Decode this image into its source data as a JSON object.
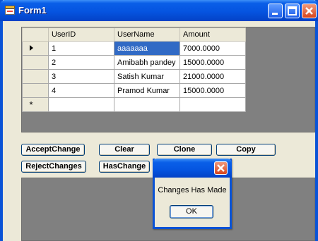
{
  "window": {
    "title": "Form1"
  },
  "grid": {
    "columns": [
      "UserID",
      "UserName",
      "Amount"
    ],
    "rows": [
      {
        "id": "1",
        "name": "aaaaaaa",
        "amount": "7000.0000"
      },
      {
        "id": "2",
        "name": "Amibabh pandey",
        "amount": "15000.0000"
      },
      {
        "id": "3",
        "name": "Satish Kumar",
        "amount": "21000.0000"
      },
      {
        "id": "4",
        "name": "Pramod Kumar",
        "amount": "15000.0000"
      }
    ],
    "new_row_marker": "*",
    "selected_row": 0,
    "selected_column": "UserName"
  },
  "buttons": {
    "accept": "AcceptChange",
    "clear": "Clear",
    "clone": "Clone",
    "copy": "Copy",
    "reject": "RejectChanges",
    "haschange": "HasChange"
  },
  "dialog": {
    "message": "Changes Has Made",
    "ok": "OK"
  },
  "colors": {
    "title_bar": "#0554e0",
    "selection": "#316ac5",
    "panel_bg": "#808080",
    "form_bg": "#ece9d8",
    "close_button": "#d8451d"
  }
}
